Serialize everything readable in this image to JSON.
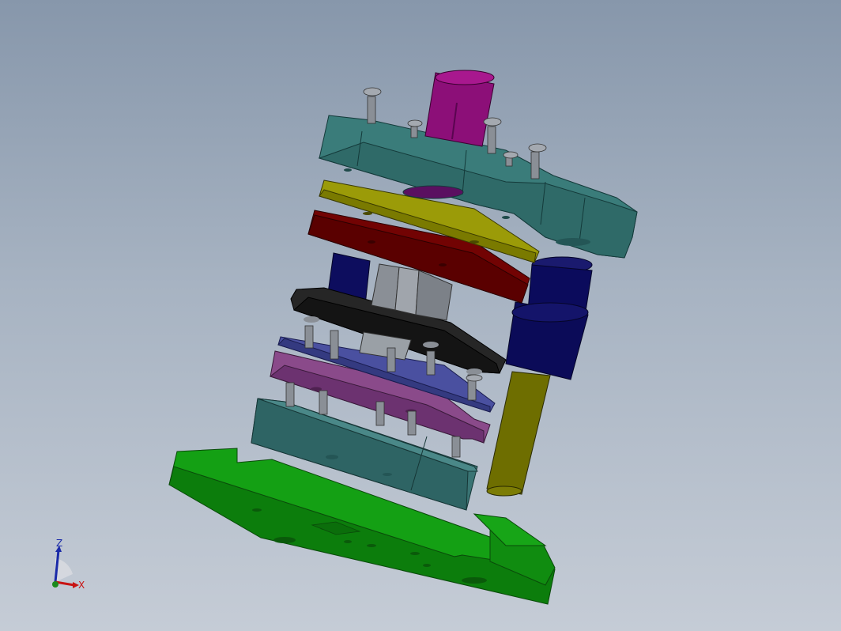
{
  "view": {
    "background_top": "#8797ab",
    "background_bottom": "#c5ccd6"
  },
  "triad": {
    "z_label": "Z",
    "x_label": "X",
    "z_color": "#1a2aa8",
    "x_color": "#c81414",
    "y_color": "#1c8a1c"
  },
  "parts": {
    "colors": {
      "die_shoe": "#0e8a0e",
      "die_block": "#356b6b",
      "stripper_plate": "#7a3d7a",
      "spacer_plate": "#3f4490",
      "punch_retainer": "#1c1c1c",
      "backing_plate": "#6a0000",
      "upper_shim": "#8a8a00",
      "top_plate": "#387a78",
      "guide_post": "#6b6b00",
      "guide_bushing": "#0a0a52",
      "shank": "#8a1075",
      "screws": "#8a8f96"
    }
  }
}
